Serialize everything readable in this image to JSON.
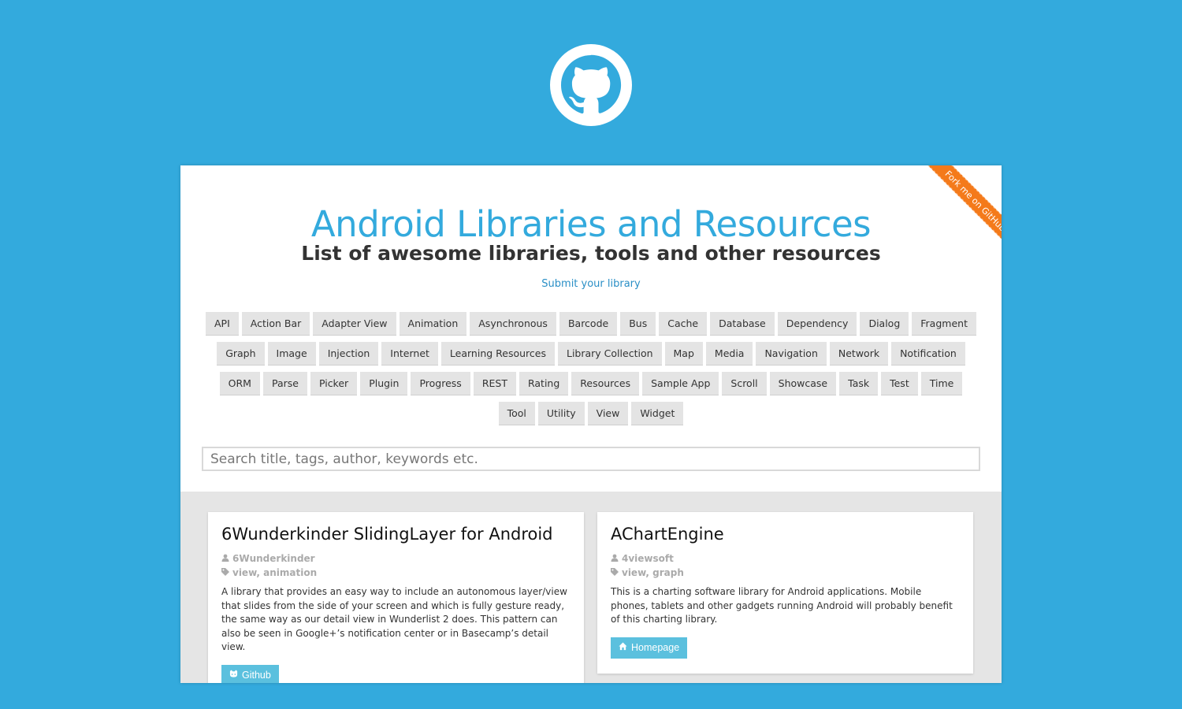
{
  "icons": {
    "top_logo": "github-octocat-icon",
    "user": "user-icon",
    "tag": "tag-icon",
    "github": "github-icon",
    "home": "home-icon"
  },
  "colors": {
    "background": "#33aadd",
    "title": "#33aadd",
    "ribbon": "#f47a1a",
    "button": "#5bc0de"
  },
  "ribbon": {
    "label": "Fork me on GitHub"
  },
  "header": {
    "title": "Android Libraries and Resources",
    "subtitle": "List of awesome libraries, tools and other resources",
    "submit_label": "Submit your library"
  },
  "tags": [
    "API",
    "Action Bar",
    "Adapter View",
    "Animation",
    "Asynchronous",
    "Barcode",
    "Bus",
    "Cache",
    "Database",
    "Dependency",
    "Dialog",
    "Fragment",
    "Graph",
    "Image",
    "Injection",
    "Internet",
    "Learning Resources",
    "Library Collection",
    "Map",
    "Media",
    "Navigation",
    "Network",
    "Notification",
    "ORM",
    "Parse",
    "Picker",
    "Plugin",
    "Progress",
    "REST",
    "Rating",
    "Resources",
    "Sample App",
    "Scroll",
    "Showcase",
    "Task",
    "Test",
    "Time",
    "Tool",
    "Utility",
    "View",
    "Widget"
  ],
  "search": {
    "placeholder": "Search title, tags, author, keywords etc.",
    "value": ""
  },
  "cards": [
    {
      "title": "6Wunderkinder SlidingLayer for Android",
      "author": "6Wunderkinder",
      "tags": "view, animation",
      "description": "A library that provides an easy way to include an autonomous layer/view that slides from the side of your screen and which is fully gesture ready, the same way as our detail view in Wunderlist 2 does. This pattern can also be seen in Google+’s notification center or in Basecamp’s detail view.",
      "button_label": "Github"
    },
    {
      "title": "AChartEngine",
      "author": "4viewsoft",
      "tags": "view, graph",
      "description": "This is a charting software library for Android applications. Mobile phones, tablets and other gadgets running Android will probably benefit of this charting library.",
      "button_label": "Homepage"
    }
  ]
}
